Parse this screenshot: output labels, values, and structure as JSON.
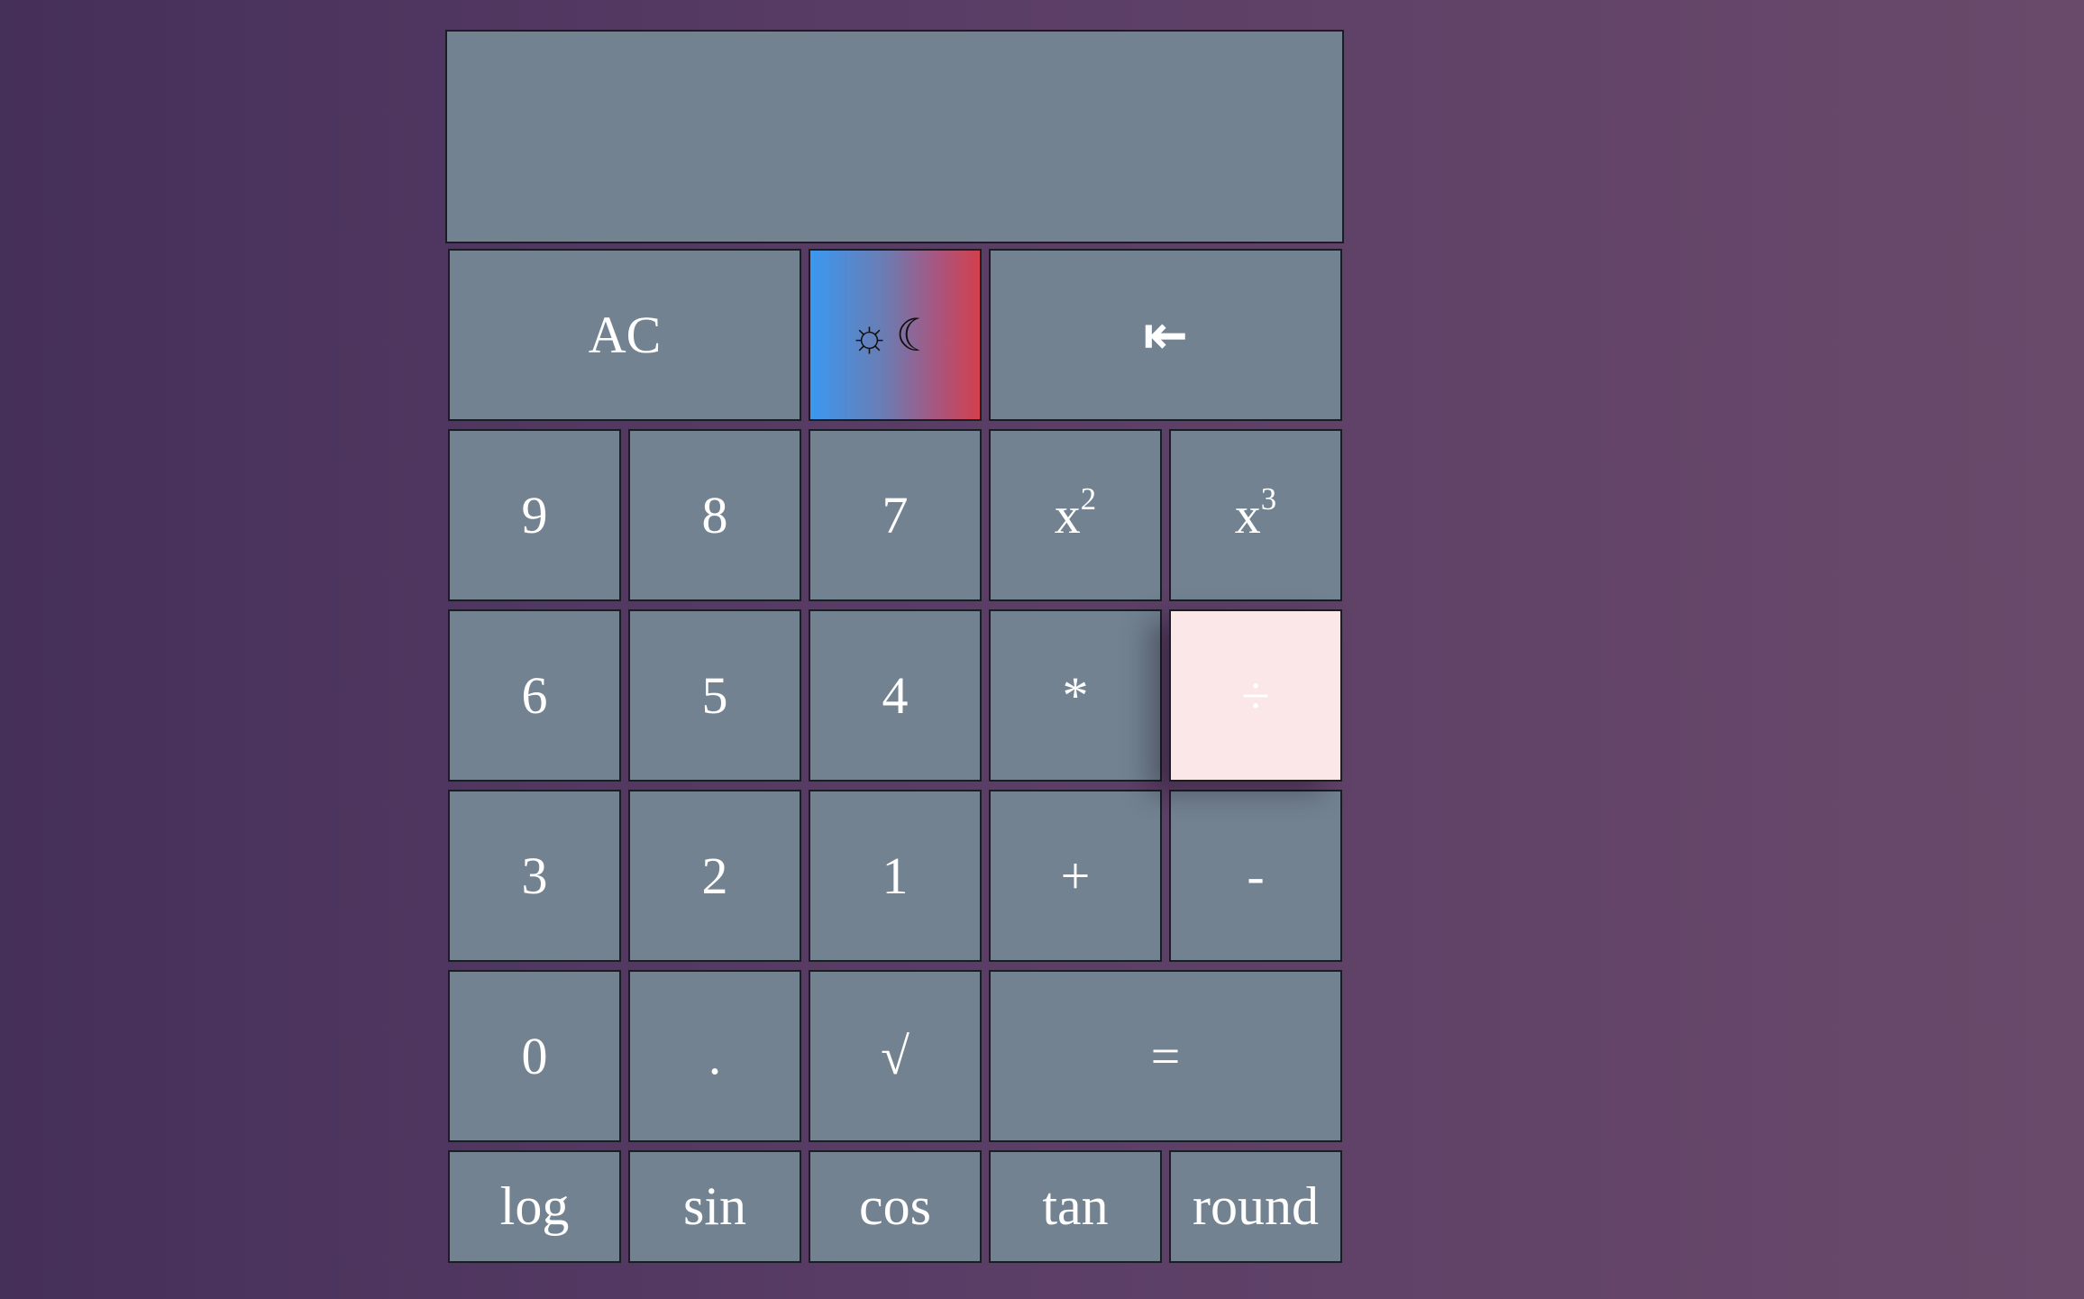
{
  "display": {
    "value": ""
  },
  "buttons": {
    "ac": "AC",
    "theme_sun": "☼",
    "theme_moon": "☾",
    "backspace": "⇤",
    "nine": "9",
    "eight": "8",
    "seven": "7",
    "square_base": "x",
    "square_exp": "2",
    "cube_base": "x",
    "cube_exp": "3",
    "six": "6",
    "five": "5",
    "four": "4",
    "multiply": "*",
    "divide": "÷",
    "three": "3",
    "two": "2",
    "one": "1",
    "plus": "+",
    "minus": "-",
    "zero": "0",
    "dot": ".",
    "sqrt": "√",
    "equals": "=",
    "log": "log",
    "sin": "sin",
    "cos": "cos",
    "tan": "tan",
    "round": "round"
  },
  "colors": {
    "background_start": "#45305a",
    "background_end": "#6a4a6b",
    "button": "#728290",
    "button_border": "#1c1c24",
    "active_button": "#fbe7e7",
    "theme_gradient_start": "#3a98f0",
    "theme_gradient_end": "#d2404c"
  }
}
